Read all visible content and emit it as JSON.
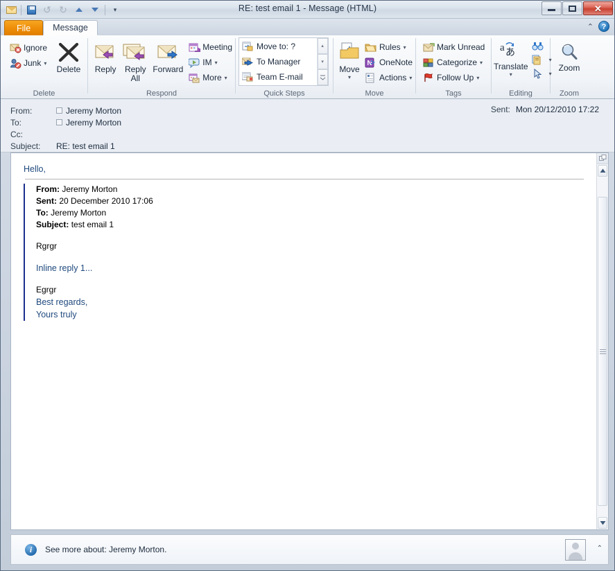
{
  "window": {
    "title": "RE: test email 1  -  Message (HTML)",
    "quick_access": [
      {
        "name": "message-icon",
        "label": "Message"
      },
      {
        "name": "save-icon",
        "label": "Save"
      },
      {
        "name": "undo-icon",
        "label": "Undo"
      },
      {
        "name": "redo-icon",
        "label": "Redo"
      },
      {
        "name": "previous-item-icon",
        "label": "Previous Item"
      },
      {
        "name": "next-item-icon",
        "label": "Next Item"
      },
      {
        "name": "customize-qat-icon",
        "label": "Customize Quick Access Toolbar"
      }
    ],
    "controls": {
      "minimize": "Minimize",
      "maximize": "Maximize",
      "close": "✕"
    }
  },
  "tabs": {
    "file": "File",
    "message": "Message",
    "minimize_ribbon": "⌃",
    "help": "?"
  },
  "ribbon": {
    "groups": [
      {
        "label": "Delete",
        "buttons": [
          {
            "label": "Ignore",
            "icon": "ignore-icon"
          },
          {
            "label": "Junk",
            "icon": "junk-icon",
            "caret": "▾"
          },
          {
            "label": "Delete",
            "icon": "delete-x-icon"
          }
        ]
      },
      {
        "label": "Respond",
        "buttons": [
          {
            "label": "Reply",
            "icon": "reply-icon"
          },
          {
            "label": "Reply All",
            "icon": "reply-all-icon"
          },
          {
            "label": "Forward",
            "icon": "forward-icon"
          },
          {
            "label": "Meeting",
            "icon": "meeting-icon"
          },
          {
            "label": "IM",
            "icon": "im-icon",
            "caret": "▾"
          },
          {
            "label": "More",
            "icon": "more-respond-icon",
            "caret": "▾"
          }
        ]
      },
      {
        "label": "Quick Steps",
        "items": [
          {
            "label": "Move to: ?",
            "icon": "move-to-icon"
          },
          {
            "label": "To Manager",
            "icon": "to-manager-icon"
          },
          {
            "label": "Team E-mail",
            "icon": "team-email-icon"
          }
        ],
        "scroll": [
          "▴",
          "▾",
          "▾"
        ],
        "launcher": "◪"
      },
      {
        "label": "Move",
        "buttons": [
          {
            "label": "Move",
            "icon": "move-icon",
            "caret": "▾"
          },
          {
            "label": "Rules",
            "icon": "rules-icon",
            "caret": "▾"
          },
          {
            "label": "OneNote",
            "icon": "onenote-icon"
          },
          {
            "label": "Actions",
            "icon": "actions-icon",
            "caret": "▾"
          }
        ]
      },
      {
        "label": "Tags",
        "buttons": [
          {
            "label": "Mark Unread",
            "icon": "mark-unread-icon"
          },
          {
            "label": "Categorize",
            "icon": "categorize-icon",
            "caret": "▾"
          },
          {
            "label": "Follow Up",
            "icon": "follow-up-icon",
            "caret": "▾"
          }
        ],
        "launcher": "◪"
      },
      {
        "label": "Editing",
        "buttons": [
          {
            "label": "Translate",
            "icon": "translate-icon",
            "caret": "▾"
          },
          {
            "label": "Find",
            "icon": "binoculars-icon"
          },
          {
            "label": "Replace",
            "icon": "replace-icon",
            "caret": "▾"
          },
          {
            "label": "Select",
            "icon": "select-cursor-icon",
            "caret": "▾"
          }
        ]
      },
      {
        "label": "Zoom",
        "buttons": [
          {
            "label": "Zoom",
            "icon": "zoom-magnifier-icon"
          }
        ]
      }
    ]
  },
  "message_header": {
    "from_label": "From:",
    "from_value": "Jeremy Morton",
    "to_label": "To:",
    "to_value": "Jeremy Morton",
    "cc_label": "Cc:",
    "cc_value": "",
    "subject_label": "Subject:",
    "subject_value": "RE: test email 1",
    "sent_label": "Sent:",
    "sent_value": "Mon 20/12/2010 17:22"
  },
  "body": {
    "greeting": "Hello,",
    "quoted": {
      "from_label": "From:",
      "from_value": "Jeremy Morton",
      "sent_label": "Sent:",
      "sent_value": "20 December 2010 17:06",
      "to_label": "To:",
      "to_value": "Jeremy Morton",
      "subject_label": "Subject:",
      "subject_value": "test email 1",
      "line1": "Rgrgr",
      "line2": "Inline reply 1...",
      "line3": "Egrgr",
      "line4": "Best regards,",
      "line5": "Yours truly"
    }
  },
  "scrollbar": {
    "split_handle": "split-pane-handle",
    "up_arrow": "▲",
    "down_arrow": "▼"
  },
  "people_pane": {
    "info": "i",
    "text": "See more about: Jeremy Morton.",
    "avatar": "contact-photo",
    "expand": "⌃"
  },
  "colors": {
    "accent_blue": "#1f497d",
    "quote_bar": "#1b2f8f",
    "file_tab_orange": "#ef8e08",
    "close_red": "#c9402f"
  }
}
